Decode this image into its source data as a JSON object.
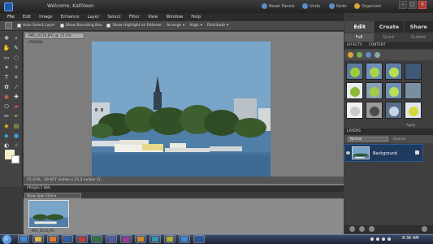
{
  "window": {
    "welcome": "Welcome, Kathleen",
    "actions": [
      "Reset Panels",
      "Undo",
      "Redo",
      "Organizer"
    ]
  },
  "menu": [
    "File",
    "Edit",
    "Image",
    "Enhance",
    "Layer",
    "Select",
    "Filter",
    "View",
    "Window",
    "Help"
  ],
  "options": {
    "auto_select": "Auto Select Layer",
    "bounding_box": "Show Bounding Box",
    "highlight": "Show Highlight on Rollover",
    "arrange": "Arrange",
    "align": "Align",
    "distribute": "Distribute"
  },
  "mode_tabs": [
    "Edit",
    "Create",
    "Share"
  ],
  "edit_subtabs": [
    "Full",
    "Quick",
    "Guided"
  ],
  "document": {
    "tab": "IMG_0114.JPG @ 15.4% (RGB/8)",
    "status_zoom": "15.43%",
    "status_info": "29.957 inches x 15.2 inches (1..."
  },
  "project_bin": {
    "title": "PROJECT BIN",
    "filter": "Show Open Files",
    "filename": "IMG_0114.JPG"
  },
  "effects": {
    "tabs": [
      "EFFECTS",
      "CONTENT"
    ],
    "apply": "Apply",
    "swatch_colors": [
      "#e0e0e0",
      "#7a8fa8",
      "#7f98bf",
      "#6f8fb8",
      "#cdd3dc",
      "#8aa0b8",
      "#7a9ac4",
      "#707f8c",
      "#f0f0f0",
      "#909090",
      "#5a6c88",
      "#c8d3e6"
    ]
  },
  "layers": {
    "title": "LAYERS",
    "blend": "Normal",
    "opacity": "Opacity",
    "background": "Background"
  },
  "taskbar": {
    "time": "8:36 AM"
  }
}
